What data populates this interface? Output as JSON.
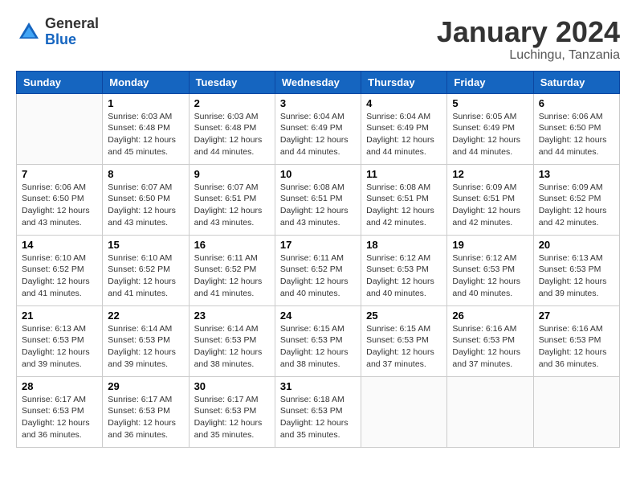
{
  "header": {
    "logo_general": "General",
    "logo_blue": "Blue",
    "month_year": "January 2024",
    "location": "Luchingu, Tanzania"
  },
  "day_headers": [
    "Sunday",
    "Monday",
    "Tuesday",
    "Wednesday",
    "Thursday",
    "Friday",
    "Saturday"
  ],
  "weeks": [
    [
      null,
      {
        "date": "1",
        "sunrise": "Sunrise: 6:03 AM",
        "sunset": "Sunset: 6:48 PM",
        "daylight": "Daylight: 12 hours and 45 minutes."
      },
      {
        "date": "2",
        "sunrise": "Sunrise: 6:03 AM",
        "sunset": "Sunset: 6:48 PM",
        "daylight": "Daylight: 12 hours and 44 minutes."
      },
      {
        "date": "3",
        "sunrise": "Sunrise: 6:04 AM",
        "sunset": "Sunset: 6:49 PM",
        "daylight": "Daylight: 12 hours and 44 minutes."
      },
      {
        "date": "4",
        "sunrise": "Sunrise: 6:04 AM",
        "sunset": "Sunset: 6:49 PM",
        "daylight": "Daylight: 12 hours and 44 minutes."
      },
      {
        "date": "5",
        "sunrise": "Sunrise: 6:05 AM",
        "sunset": "Sunset: 6:49 PM",
        "daylight": "Daylight: 12 hours and 44 minutes."
      },
      {
        "date": "6",
        "sunrise": "Sunrise: 6:06 AM",
        "sunset": "Sunset: 6:50 PM",
        "daylight": "Daylight: 12 hours and 44 minutes."
      }
    ],
    [
      {
        "date": "7",
        "sunrise": "Sunrise: 6:06 AM",
        "sunset": "Sunset: 6:50 PM",
        "daylight": "Daylight: 12 hours and 43 minutes."
      },
      {
        "date": "8",
        "sunrise": "Sunrise: 6:07 AM",
        "sunset": "Sunset: 6:50 PM",
        "daylight": "Daylight: 12 hours and 43 minutes."
      },
      {
        "date": "9",
        "sunrise": "Sunrise: 6:07 AM",
        "sunset": "Sunset: 6:51 PM",
        "daylight": "Daylight: 12 hours and 43 minutes."
      },
      {
        "date": "10",
        "sunrise": "Sunrise: 6:08 AM",
        "sunset": "Sunset: 6:51 PM",
        "daylight": "Daylight: 12 hours and 43 minutes."
      },
      {
        "date": "11",
        "sunrise": "Sunrise: 6:08 AM",
        "sunset": "Sunset: 6:51 PM",
        "daylight": "Daylight: 12 hours and 42 minutes."
      },
      {
        "date": "12",
        "sunrise": "Sunrise: 6:09 AM",
        "sunset": "Sunset: 6:51 PM",
        "daylight": "Daylight: 12 hours and 42 minutes."
      },
      {
        "date": "13",
        "sunrise": "Sunrise: 6:09 AM",
        "sunset": "Sunset: 6:52 PM",
        "daylight": "Daylight: 12 hours and 42 minutes."
      }
    ],
    [
      {
        "date": "14",
        "sunrise": "Sunrise: 6:10 AM",
        "sunset": "Sunset: 6:52 PM",
        "daylight": "Daylight: 12 hours and 41 minutes."
      },
      {
        "date": "15",
        "sunrise": "Sunrise: 6:10 AM",
        "sunset": "Sunset: 6:52 PM",
        "daylight": "Daylight: 12 hours and 41 minutes."
      },
      {
        "date": "16",
        "sunrise": "Sunrise: 6:11 AM",
        "sunset": "Sunset: 6:52 PM",
        "daylight": "Daylight: 12 hours and 41 minutes."
      },
      {
        "date": "17",
        "sunrise": "Sunrise: 6:11 AM",
        "sunset": "Sunset: 6:52 PM",
        "daylight": "Daylight: 12 hours and 40 minutes."
      },
      {
        "date": "18",
        "sunrise": "Sunrise: 6:12 AM",
        "sunset": "Sunset: 6:53 PM",
        "daylight": "Daylight: 12 hours and 40 minutes."
      },
      {
        "date": "19",
        "sunrise": "Sunrise: 6:12 AM",
        "sunset": "Sunset: 6:53 PM",
        "daylight": "Daylight: 12 hours and 40 minutes."
      },
      {
        "date": "20",
        "sunrise": "Sunrise: 6:13 AM",
        "sunset": "Sunset: 6:53 PM",
        "daylight": "Daylight: 12 hours and 39 minutes."
      }
    ],
    [
      {
        "date": "21",
        "sunrise": "Sunrise: 6:13 AM",
        "sunset": "Sunset: 6:53 PM",
        "daylight": "Daylight: 12 hours and 39 minutes."
      },
      {
        "date": "22",
        "sunrise": "Sunrise: 6:14 AM",
        "sunset": "Sunset: 6:53 PM",
        "daylight": "Daylight: 12 hours and 39 minutes."
      },
      {
        "date": "23",
        "sunrise": "Sunrise: 6:14 AM",
        "sunset": "Sunset: 6:53 PM",
        "daylight": "Daylight: 12 hours and 38 minutes."
      },
      {
        "date": "24",
        "sunrise": "Sunrise: 6:15 AM",
        "sunset": "Sunset: 6:53 PM",
        "daylight": "Daylight: 12 hours and 38 minutes."
      },
      {
        "date": "25",
        "sunrise": "Sunrise: 6:15 AM",
        "sunset": "Sunset: 6:53 PM",
        "daylight": "Daylight: 12 hours and 37 minutes."
      },
      {
        "date": "26",
        "sunrise": "Sunrise: 6:16 AM",
        "sunset": "Sunset: 6:53 PM",
        "daylight": "Daylight: 12 hours and 37 minutes."
      },
      {
        "date": "27",
        "sunrise": "Sunrise: 6:16 AM",
        "sunset": "Sunset: 6:53 PM",
        "daylight": "Daylight: 12 hours and 36 minutes."
      }
    ],
    [
      {
        "date": "28",
        "sunrise": "Sunrise: 6:17 AM",
        "sunset": "Sunset: 6:53 PM",
        "daylight": "Daylight: 12 hours and 36 minutes."
      },
      {
        "date": "29",
        "sunrise": "Sunrise: 6:17 AM",
        "sunset": "Sunset: 6:53 PM",
        "daylight": "Daylight: 12 hours and 36 minutes."
      },
      {
        "date": "30",
        "sunrise": "Sunrise: 6:17 AM",
        "sunset": "Sunset: 6:53 PM",
        "daylight": "Daylight: 12 hours and 35 minutes."
      },
      {
        "date": "31",
        "sunrise": "Sunrise: 6:18 AM",
        "sunset": "Sunset: 6:53 PM",
        "daylight": "Daylight: 12 hours and 35 minutes."
      },
      null,
      null,
      null
    ]
  ]
}
